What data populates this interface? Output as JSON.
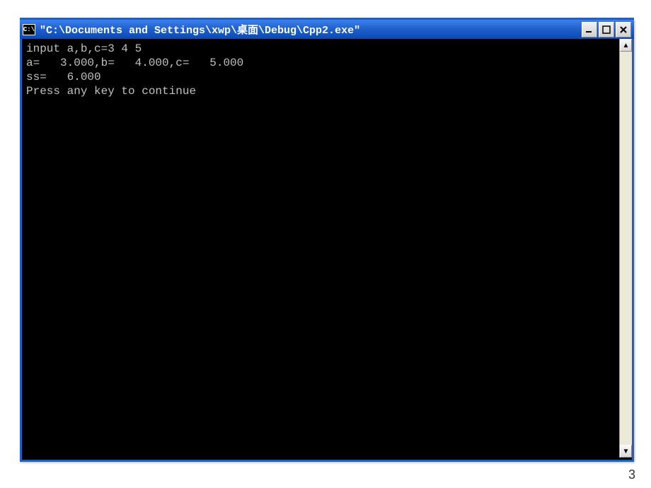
{
  "window": {
    "icon_text": "C:\\",
    "title": "\"C:\\Documents and Settings\\xwp\\桌面\\Debug\\Cpp2.exe\""
  },
  "console": {
    "lines": [
      "input a,b,c=3 4 5",
      "a=   3.000,b=   4.000,c=   5.000",
      "ss=   6.000",
      "Press any key to continue"
    ]
  },
  "page_number": "3"
}
